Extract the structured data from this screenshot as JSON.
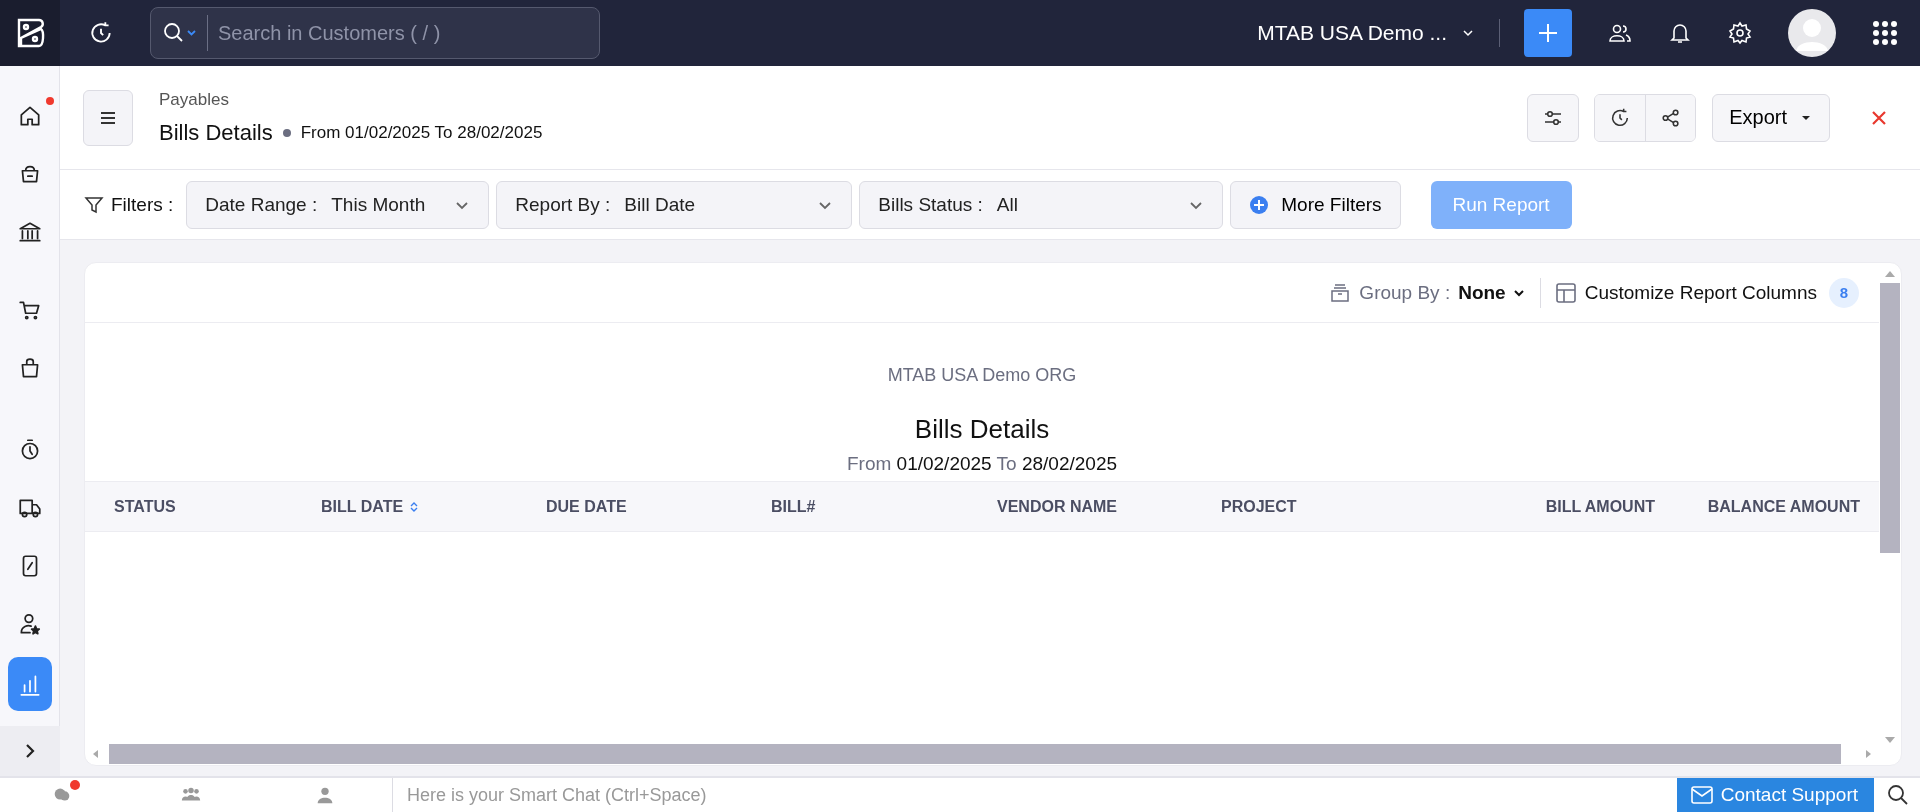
{
  "top_bar": {
    "search": {
      "placeholder": "Search in Customers ( / )"
    },
    "organization": "MTAB USA Demo ..."
  },
  "sidebar": {
    "items": [
      {
        "kind": "home",
        "selected": false,
        "notification": true
      },
      {
        "kind": "basket",
        "selected": false,
        "notification": false
      },
      {
        "kind": "bank",
        "selected": false,
        "notification": false
      },
      {
        "kind": "cart",
        "selected": false,
        "notification": false
      },
      {
        "kind": "bag",
        "selected": false,
        "notification": false
      },
      {
        "kind": "timer",
        "selected": false,
        "notification": false
      },
      {
        "kind": "truck",
        "selected": false,
        "notification": false
      },
      {
        "kind": "percent",
        "selected": false,
        "notification": false
      },
      {
        "kind": "person",
        "selected": false,
        "notification": false
      },
      {
        "kind": "chart",
        "selected": true,
        "notification": false
      }
    ]
  },
  "header": {
    "breadcrumb": "Payables",
    "title": "Bills Details",
    "period": "From 01/02/2025 To 28/02/2025",
    "export": "Export"
  },
  "filters": {
    "label": "Filters :",
    "items": [
      {
        "label": "Date Range :",
        "value": "This Month"
      },
      {
        "label": "Report By :",
        "value": "Bill Date"
      },
      {
        "label": "Bills Status :",
        "value": "All"
      }
    ],
    "more": "More Filters",
    "run": "Run Report",
    "run_disabled": true
  },
  "report": {
    "group_by_label": "Group By :",
    "group_by_value": "None",
    "customize": "Customize Report Columns",
    "column_count": "8",
    "organization": "MTAB USA Demo ORG",
    "title": "Bills Details",
    "subtitle": {
      "from": "From",
      "start": "01/02/2025",
      "to": "To",
      "end": "28/02/2025"
    },
    "columns": [
      {
        "label": "STATUS",
        "sortable": false,
        "numeric": false
      },
      {
        "label": "BILL DATE",
        "sortable": true,
        "numeric": false
      },
      {
        "label": "DUE DATE",
        "sortable": false,
        "numeric": false
      },
      {
        "label": "BILL#",
        "sortable": false,
        "numeric": false
      },
      {
        "label": "VENDOR NAME",
        "sortable": false,
        "numeric": false
      },
      {
        "label": "PROJECT",
        "sortable": false,
        "numeric": false
      },
      {
        "label": "BILL AMOUNT",
        "sortable": false,
        "numeric": true
      },
      {
        "label": "BALANCE AMOUNT",
        "sortable": false,
        "numeric": true
      }
    ]
  },
  "bottom_bar": {
    "tabs": [
      {
        "kind": "chats",
        "notification": true
      },
      {
        "kind": "channels",
        "notification": false
      },
      {
        "kind": "contacts",
        "notification": false
      }
    ],
    "chat_placeholder": "Here is your Smart Chat (Ctrl+Space)",
    "contact": "Contact Support"
  }
}
